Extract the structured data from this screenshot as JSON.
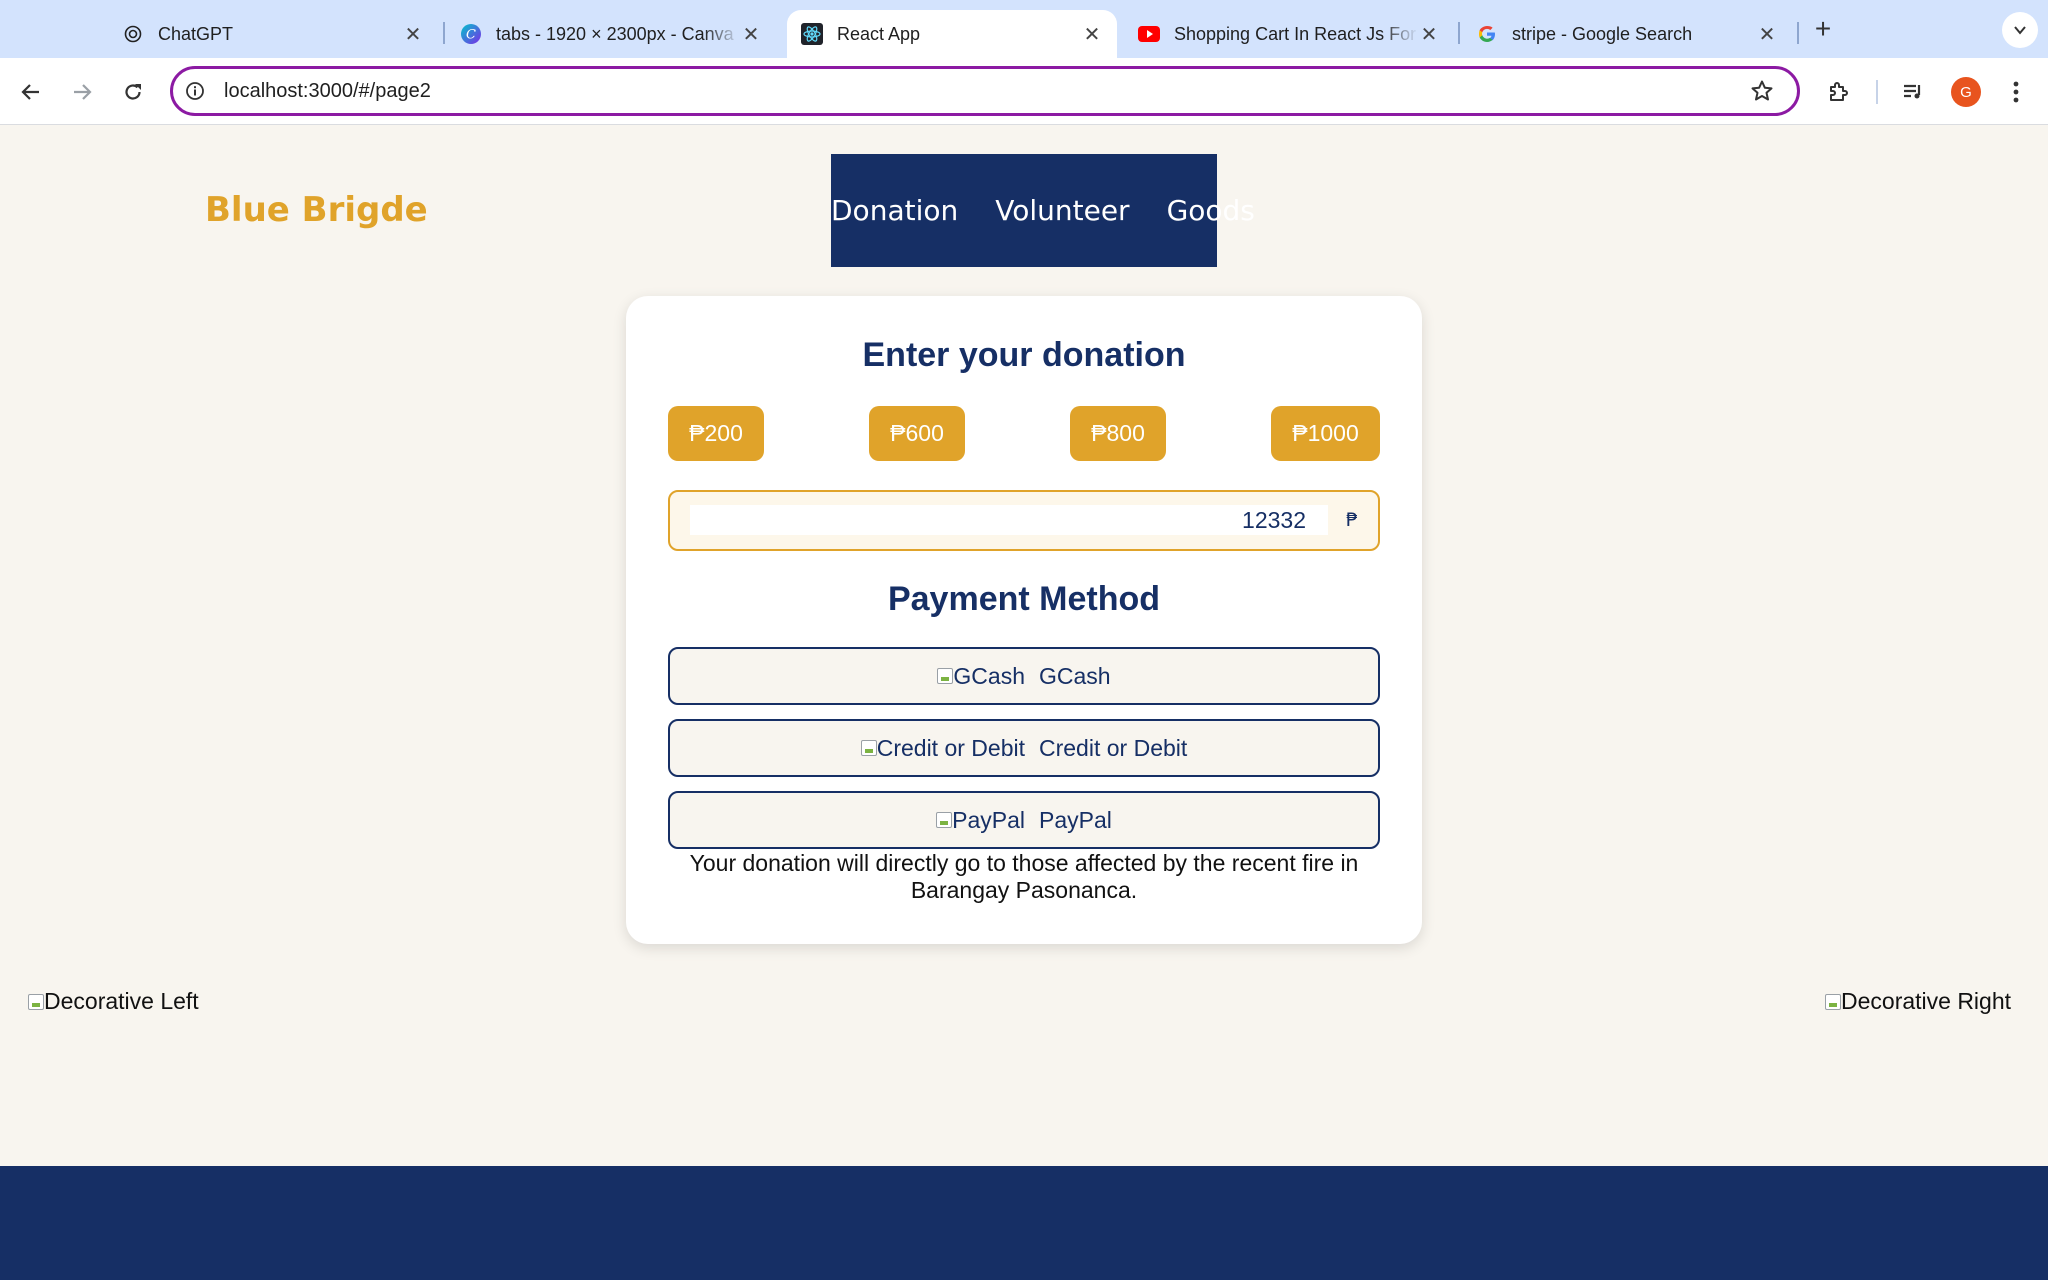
{
  "browser": {
    "tabs": [
      {
        "title": "ChatGPT",
        "icon": "chatgpt-icon"
      },
      {
        "title": "tabs - 1920 × 2300px - Canva",
        "icon": "canva-icon"
      },
      {
        "title": "React App",
        "icon": "react-icon",
        "active": true
      },
      {
        "title": "Shopping Cart In React Js For Beginners",
        "icon": "youtube-icon"
      },
      {
        "title": "stripe - Google Search",
        "icon": "google-icon"
      }
    ],
    "url": "localhost:3000/#/page2",
    "profile_initial": "G",
    "accent": "#8c1aa3"
  },
  "header": {
    "brand": "Blue Brigde",
    "nav": [
      "Donation",
      "Volunteer",
      "Goods"
    ]
  },
  "donation": {
    "title": "Enter your donation",
    "preset_amounts": [
      "₱200",
      "₱600",
      "₱800",
      "₱1000"
    ],
    "amount_value": "12332",
    "currency_symbol": "₱",
    "payment_title": "Payment Method",
    "methods": [
      {
        "alt": "GCash",
        "label": "GCash"
      },
      {
        "alt": "Credit or Debit",
        "label": "Credit or Debit"
      },
      {
        "alt": "PayPal",
        "label": "PayPal"
      }
    ],
    "note": "Your donation will directly go to those affected by the recent fire in Barangay Pasonanca."
  },
  "decor": {
    "left": "Decorative Left",
    "right": "Decorative Right"
  },
  "colors": {
    "navy": "#162f65",
    "gold": "#e0a32a",
    "page_bg": "#f8f5ef"
  }
}
